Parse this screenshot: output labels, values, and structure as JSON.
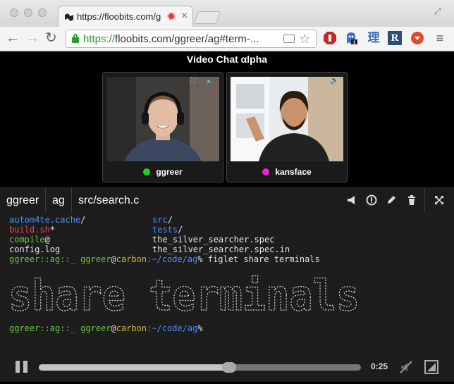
{
  "browser": {
    "tab_title": "https://floobits.com/gg",
    "url_scheme": "https://",
    "url_rest": "floobits.com/ggreer/ag#term-...",
    "extensions": [
      "adblock-icon",
      "ghostery-icon",
      "dictionary-icon",
      "r-icon",
      "download-icon"
    ],
    "ext_labels": {
      "dict": "理",
      "r": "R"
    }
  },
  "video_chat": {
    "title": "Video Chat αlpha",
    "participants": [
      {
        "name": "ggreer",
        "status_color": "#19d32a"
      },
      {
        "name": "kansface",
        "status_color": "#f51fd6"
      }
    ]
  },
  "terminal_bar": {
    "breadcrumbs": [
      "ggreer",
      "ag",
      "src/search.c"
    ]
  },
  "terminal": {
    "listing": [
      {
        "left": "autom4te.cache",
        "left_suffix": "/",
        "left_color": "blue",
        "right": "src",
        "right_suffix": "/",
        "right_color": "blue"
      },
      {
        "left": "build.sh",
        "left_suffix": "*",
        "left_color": "red",
        "right": "tests",
        "right_suffix": "/",
        "right_color": "blue"
      },
      {
        "left": "compile",
        "left_suffix": "@",
        "left_color": "green",
        "right": "the_silver_searcher.spec",
        "right_suffix": "",
        "right_color": "white"
      },
      {
        "left": "config.log",
        "left_suffix": "",
        "left_color": "white",
        "right": "the_silver_searcher.spec.in",
        "right_suffix": "",
        "right_color": "white"
      }
    ],
    "prompt_user": "ggreer::ag::_ ggreer",
    "prompt_at": "@",
    "prompt_host": "carbon",
    "prompt_path": ":~/code/ag",
    "prompt_symbol": "%",
    "command": " figlet share terminals",
    "banner_text": "share terminals"
  },
  "player": {
    "time": "0:25",
    "progress": 0.59
  }
}
